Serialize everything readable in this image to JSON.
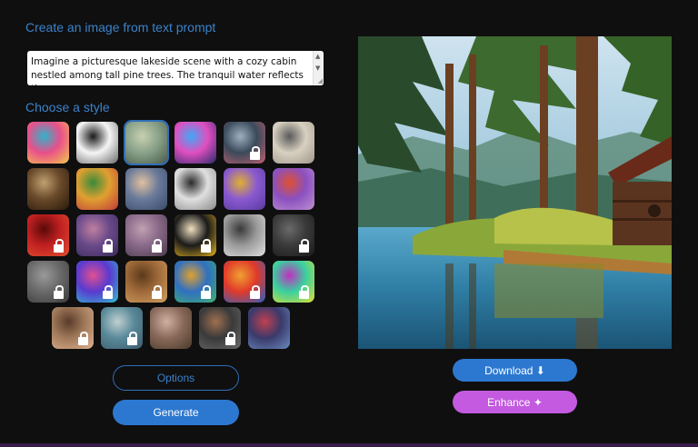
{
  "headings": {
    "create": "Create an image from text prompt",
    "style": "Choose a style"
  },
  "prompt": {
    "value": "Imagine a picturesque lakeside scene with a cozy cabin nestled among tall pine trees. The tranquil water reflects the"
  },
  "styles": {
    "rows": [
      [
        {
          "name": "psychedelic-abstract",
          "locked": false,
          "selected": false
        },
        {
          "name": "panda",
          "locked": false,
          "selected": false
        },
        {
          "name": "landscape-ruins",
          "locked": false,
          "selected": true
        },
        {
          "name": "neon-robot",
          "locked": false,
          "selected": false
        },
        {
          "name": "anime-girl",
          "locked": true,
          "selected": false
        },
        {
          "name": "vintage-sketch",
          "locked": false,
          "selected": false
        }
      ],
      [
        {
          "name": "renaissance-portrait",
          "locked": false,
          "selected": false
        },
        {
          "name": "flower-still-life",
          "locked": false,
          "selected": false
        },
        {
          "name": "ballet-dancers",
          "locked": false,
          "selected": false
        },
        {
          "name": "op-art-spiral",
          "locked": false,
          "selected": false
        },
        {
          "name": "isometric-cube",
          "locked": false,
          "selected": false
        },
        {
          "name": "paper-flower",
          "locked": false,
          "selected": false
        }
      ],
      [
        {
          "name": "red-skull",
          "locked": true,
          "selected": false
        },
        {
          "name": "purple-portrait",
          "locked": true,
          "selected": false
        },
        {
          "name": "soft-figure",
          "locked": true,
          "selected": false
        },
        {
          "name": "pop-art-face",
          "locked": true,
          "selected": false
        },
        {
          "name": "architecture",
          "locked": false,
          "selected": false
        },
        {
          "name": "dark-figure",
          "locked": true,
          "selected": false
        }
      ],
      [
        {
          "name": "pixel-blur",
          "locked": true,
          "selected": false
        },
        {
          "name": "neon-portrait",
          "locked": true,
          "selected": false
        },
        {
          "name": "bronze-sculpture",
          "locked": true,
          "selected": false
        },
        {
          "name": "pattern-grid",
          "locked": true,
          "selected": false
        },
        {
          "name": "fire-abstract",
          "locked": true,
          "selected": false
        },
        {
          "name": "colorful-glitch",
          "locked": true,
          "selected": false
        }
      ],
      [
        {
          "name": "fantasy-warrior",
          "locked": true,
          "selected": false
        },
        {
          "name": "pastel-figure",
          "locked": true,
          "selected": false
        },
        {
          "name": "classic-portrait",
          "locked": false,
          "selected": false
        },
        {
          "name": "pirate-portrait",
          "locked": true,
          "selected": false
        },
        {
          "name": "cyber-face",
          "locked": false,
          "selected": false
        }
      ]
    ]
  },
  "buttons": {
    "options": "Options",
    "generate": "Generate",
    "download": "Download ⬇",
    "enhance": "Enhance ✦"
  },
  "colors": {
    "background": "#0f0f10",
    "accent": "#2c78d0",
    "heading": "#3b82c9",
    "enhance": "#c35adf"
  }
}
